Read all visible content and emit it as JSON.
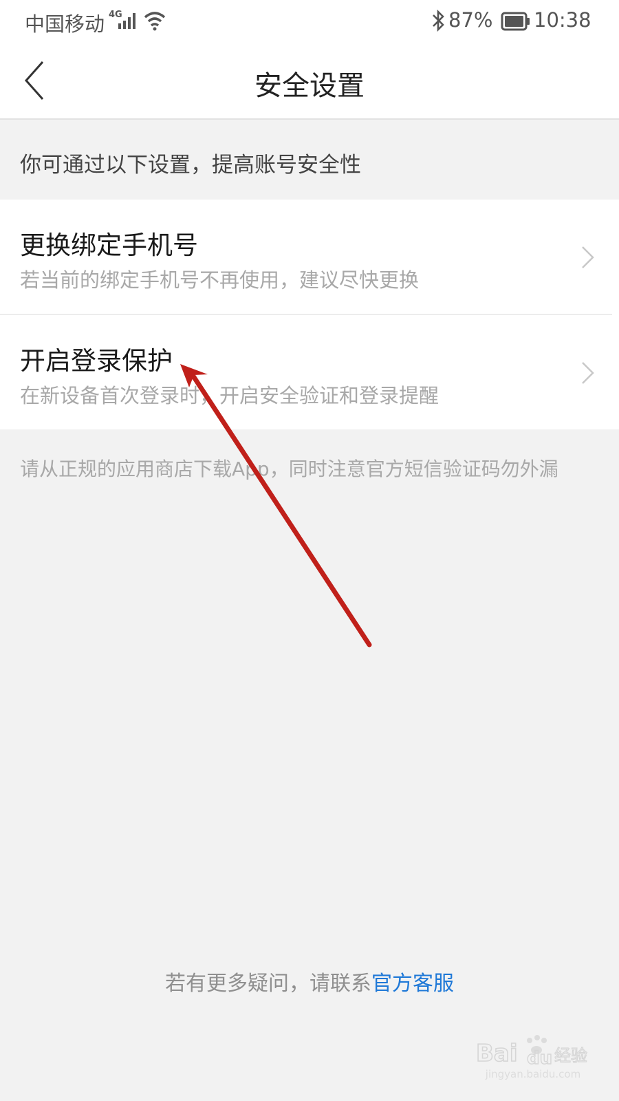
{
  "status_bar": {
    "carrier": "中国移动",
    "network_type": "4G",
    "battery_percent": "87%",
    "battery_level": 0.87,
    "time": "10:38"
  },
  "nav": {
    "title": "安全设置"
  },
  "hint": "你可通过以下设置，提高账号安全性",
  "items": [
    {
      "title": "更换绑定手机号",
      "subtitle": "若当前的绑定手机号不再使用，建议尽快更换"
    },
    {
      "title": "开启登录保护",
      "subtitle": "在新设备首次登录时，开启安全验证和登录提醒"
    }
  ],
  "notice": "请从正规的应用商店下载App，同时注意官方短信验证码勿外漏",
  "help": {
    "prefix": "若有更多疑问，请联系",
    "link": "官方客服"
  },
  "watermark": {
    "brand": "Baidu经验",
    "url": "jingyan.baidu.com"
  },
  "colors": {
    "link": "#1e78d7",
    "annotation_arrow": "#c0201a",
    "background": "#f2f2f2"
  }
}
